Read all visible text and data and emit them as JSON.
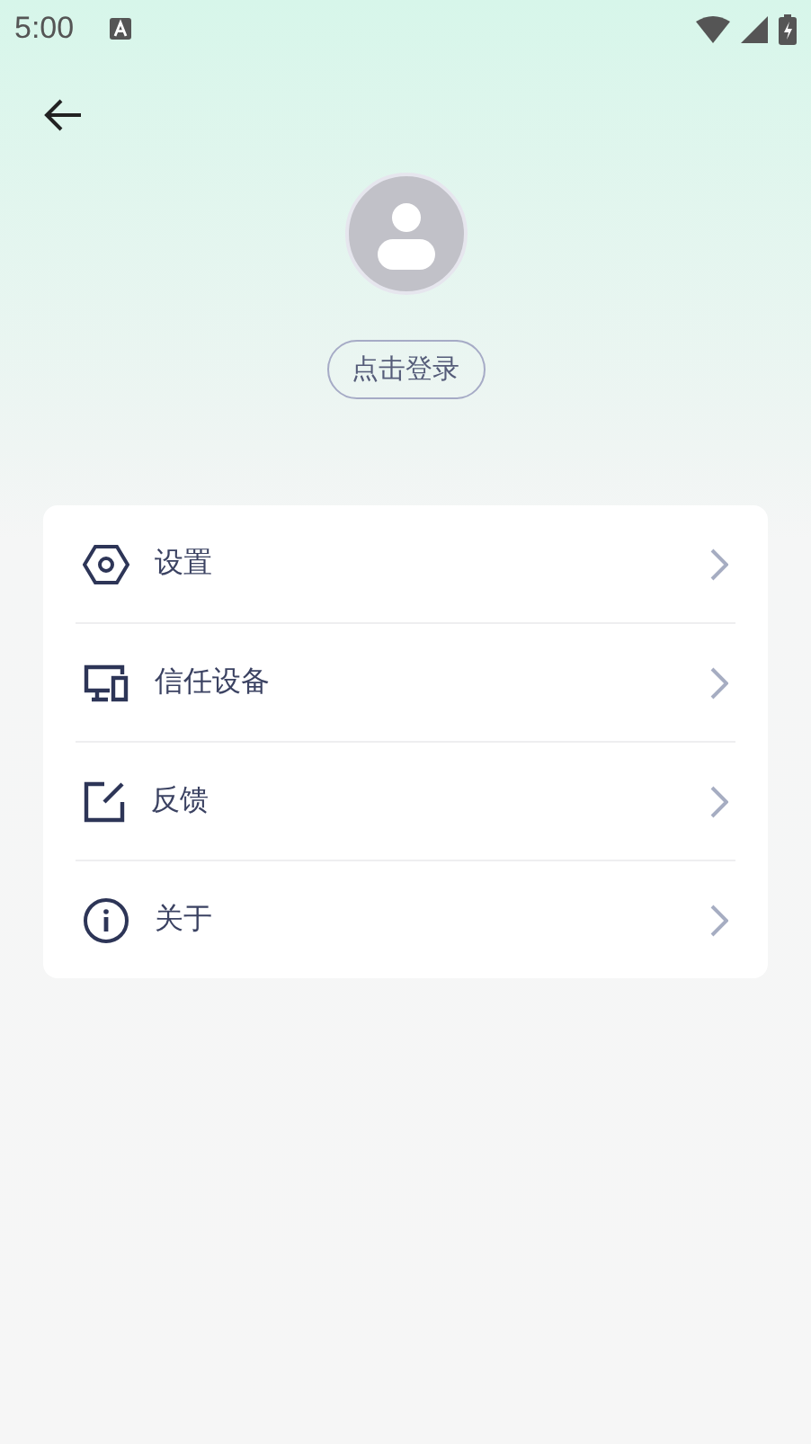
{
  "status_bar": {
    "time": "5:00"
  },
  "login_button": {
    "label": "点击登录"
  },
  "menu": [
    {
      "kind": "settings",
      "label": "设置"
    },
    {
      "kind": "devices",
      "label": "信任设备"
    },
    {
      "kind": "feedback",
      "label": "反馈"
    },
    {
      "kind": "about",
      "label": "关于"
    }
  ]
}
